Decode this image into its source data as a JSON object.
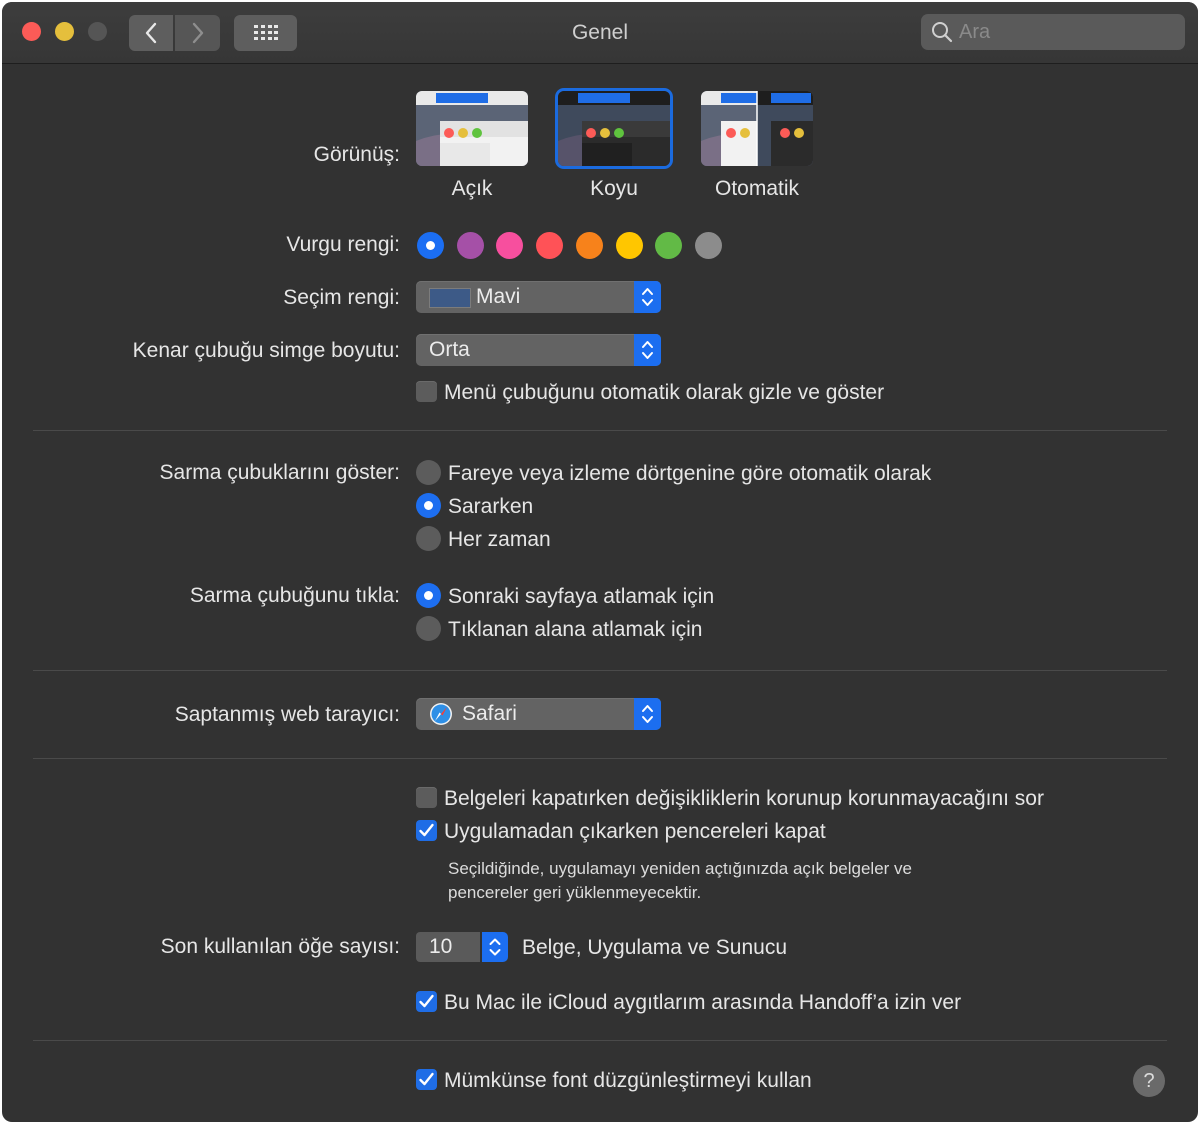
{
  "window": {
    "title": "Genel"
  },
  "search": {
    "placeholder": "Ara"
  },
  "appearance": {
    "label": "Görünüş:",
    "options": [
      {
        "label": "Açık",
        "selected": false
      },
      {
        "label": "Koyu",
        "selected": true
      },
      {
        "label": "Otomatik",
        "selected": false
      }
    ]
  },
  "accent": {
    "label": "Vurgu rengi:",
    "colors": [
      "#1b6ef3",
      "#a550a7",
      "#f74f9e",
      "#ff5257",
      "#f7821b",
      "#ffc600",
      "#62ba46",
      "#8c8c8c"
    ],
    "selected_index": 0
  },
  "highlight": {
    "label": "Seçim rengi:",
    "value": "Mavi",
    "swatch_color": "#3d5a87"
  },
  "sidebar_icon_size": {
    "label": "Kenar çubuğu simge boyutu:",
    "value": "Orta"
  },
  "menubar_autohide": {
    "label": "Menü çubuğunu otomatik olarak gizle ve göster",
    "checked": false
  },
  "scrollbars": {
    "label": "Sarma çubuklarını göster:",
    "options": [
      {
        "label": "Fareye veya izleme dörtgenine göre otomatik olarak",
        "selected": false
      },
      {
        "label": "Sararken",
        "selected": true
      },
      {
        "label": "Her zaman",
        "selected": false
      }
    ]
  },
  "scroll_click": {
    "label": "Sarma çubuğunu tıkla:",
    "options": [
      {
        "label": "Sonraki sayfaya atlamak için",
        "selected": true
      },
      {
        "label": "Tıklanan alana atlamak için",
        "selected": false
      }
    ]
  },
  "browser": {
    "label": "Saptanmış web tarayıcı:",
    "value": "Safari"
  },
  "ask_keep_changes": {
    "label": "Belgeleri kapatırken değişikliklerin korunup korunmayacağını sor",
    "checked": false
  },
  "close_windows": {
    "label": "Uygulamadan çıkarken pencereleri kapat",
    "checked": true,
    "note_line1": "Seçildiğinde, uygulamayı yeniden açtığınızda açık belgeler ve",
    "note_line2": "pencereler geri yüklenmeyecektir."
  },
  "recent_items": {
    "label": "Son kullanılan öğe sayısı:",
    "value": "10",
    "suffix": "Belge, Uygulama ve Sunucu"
  },
  "handoff": {
    "label": "Bu Mac ile iCloud aygıtlarım arasında Handoff’a izin ver",
    "checked": true
  },
  "font_smoothing": {
    "label": "Mümkünse font düzgünleştirmeyi kullan",
    "checked": true
  },
  "help": {
    "label": "?"
  }
}
